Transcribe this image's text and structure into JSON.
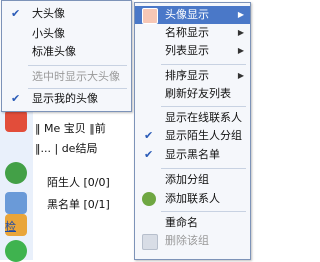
{
  "left_menu": {
    "items": [
      {
        "label": "大头像",
        "checked": true,
        "enabled": true
      },
      {
        "label": "小头像",
        "checked": false,
        "enabled": true
      },
      {
        "label": "标准头像",
        "checked": false,
        "enabled": true
      },
      {
        "label": "选中时显示大头像",
        "checked": false,
        "enabled": false
      },
      {
        "label": "显示我的头像",
        "checked": true,
        "enabled": true
      }
    ]
  },
  "right_menu": {
    "items": [
      {
        "label": "头像显示",
        "highlight": true,
        "submenu": true
      },
      {
        "label": "名称显示",
        "submenu": true
      },
      {
        "label": "列表显示",
        "submenu": true
      },
      {
        "label": "排序显示",
        "submenu": true
      },
      {
        "label": "刷新好友列表"
      },
      {
        "label": "显示在线联系人"
      },
      {
        "label": "显示陌生人分组",
        "checked": true
      },
      {
        "label": "显示黑名单",
        "checked": true
      },
      {
        "label": "添加分组"
      },
      {
        "label": "添加联系人"
      },
      {
        "label": "重命名"
      },
      {
        "label": "删除该组",
        "enabled": false
      }
    ]
  },
  "background": {
    "rows": [
      {
        "text": "‖ Me  宝贝 ‖前"
      },
      {
        "text": "‖... | de结局"
      },
      {
        "text": "陌生人 [0/0]"
      },
      {
        "text": "黑名单 [0/1]"
      }
    ],
    "link": "检"
  },
  "icons": {
    "check": "check-icon",
    "arrow": "chevron-right-icon",
    "avatar_display": "avatar-display-icon",
    "add_contact": "add-contact-icon",
    "delete_group": "delete-group-icon"
  },
  "colors": {
    "menu_bg": "#f5f7fb",
    "border": "#7d93b8",
    "highlight": "#4a78c8",
    "check": "#2a5bb7"
  }
}
